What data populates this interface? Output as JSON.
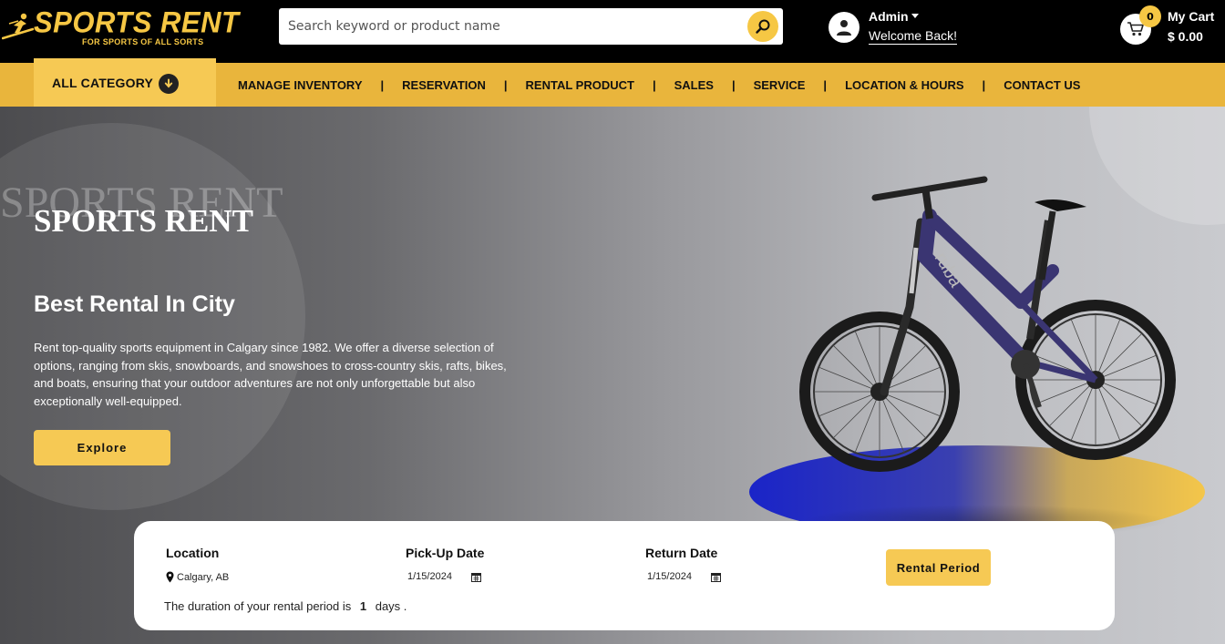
{
  "brand": {
    "name": "SPORTS RENT",
    "tagline": "FOR SPORTS OF ALL SORTS",
    "accent_color": "#f6c744",
    "nav_color": "#e9b53c"
  },
  "search": {
    "placeholder": "Search keyword or product name",
    "value": "",
    "icon": "search-icon"
  },
  "account": {
    "name": "Admin",
    "greeting": "Welcome Back!",
    "icon": "user-icon"
  },
  "cart": {
    "count": "0",
    "label": "My Cart",
    "total": "$ 0.00",
    "icon": "cart-icon"
  },
  "nav": {
    "all_category": "ALL CATEGORY",
    "links": [
      "MANAGE INVENTORY",
      "RESERVATION",
      "RENTAL PRODUCT",
      "SALES",
      "SERVICE",
      "LOCATION & HOURS",
      "CONTACT US"
    ],
    "separator": "|"
  },
  "hero": {
    "ghost_title": "SPORTS RENT",
    "title": "SPORTS RENT",
    "subtitle": "Best Rental In City",
    "description": "Rent top-quality sports equipment in Calgary since 1982. We offer a diverse selection of options, ranging from skis, snowboards, and snowshoes to cross-country skis, rafts, bikes, and boats, ensuring that your outdoor adventures are not only unforgettable but also exceptionally well-equipped.",
    "cta": "Explore"
  },
  "booking": {
    "location_label": "Location",
    "location_value": "Calgary, AB",
    "pickup_label": "Pick-Up Date",
    "pickup_value": "1/15/2024",
    "return_label": "Return Date",
    "return_value": "1/15/2024",
    "button": "Rental Period",
    "duration_prefix": "The duration of your rental period is",
    "duration_value": "1",
    "duration_suffix": "days ."
  }
}
